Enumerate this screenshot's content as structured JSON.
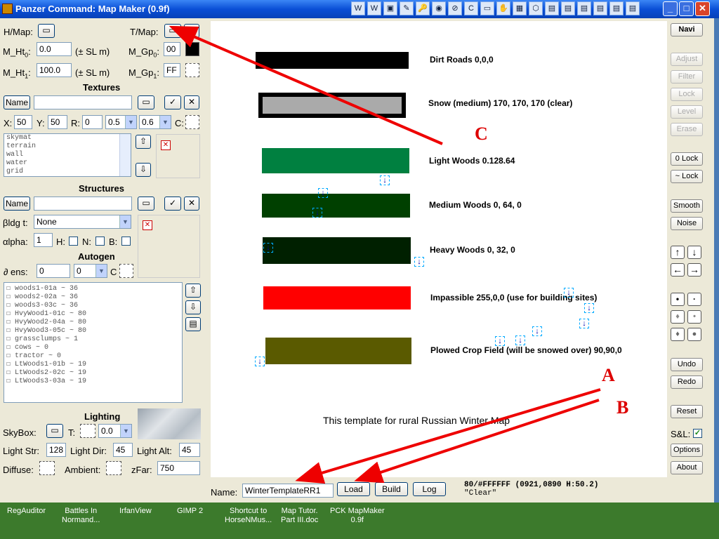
{
  "window": {
    "title": "Panzer Command: Map Maker (0.9f)",
    "min": "_",
    "max": "□",
    "close": "✕"
  },
  "tray_icons": [
    "W",
    "W",
    "▣",
    "✎",
    "🔑",
    "◉",
    "⊘",
    "C",
    "▭",
    "✋",
    "▦",
    "⬡",
    "▤",
    "▤",
    "▤",
    "▤",
    "▤",
    "▤"
  ],
  "left": {
    "hmap_label": "H/Map:",
    "tmap_label": "T/Map:",
    "mht0_label": "M_Ht",
    "mht0_sub": "0",
    "mht0_colon": ":",
    "mht0_value": "0.0",
    "mht0_unit": "(± SL m)",
    "mgp0_label": "M_Gp",
    "mgp0_sub": "0",
    "mgp0_colon": ":",
    "mgp0_value": "00",
    "mht1_label": "M_Ht",
    "mht1_sub": "1",
    "mht1_colon": ":",
    "mht1_value": "100.0",
    "mht1_unit": "(± SL m)",
    "mgp1_label": "M_Gp",
    "mgp1_sub": "1",
    "mgp1_colon": ":",
    "mgp1_value": "FF",
    "textures_header": "Textures",
    "name_button": "Name",
    "x_label": "X:",
    "x_value": "50",
    "y_label": "Y:",
    "y_value": "50",
    "r_label": "R:",
    "r_value": "0",
    "sel1_value": "0.5",
    "sel2_value": "0.6",
    "c_label": "C:",
    "texture_list": [
      "skymat",
      "terrain",
      "wall",
      "water",
      "grid"
    ],
    "structures_header": "Structures",
    "bldg_label": "βldg t:",
    "bldg_value": "None",
    "alpha_label": "αlpha:",
    "alpha_value": "1",
    "h_label": "H:",
    "n_label": "N:",
    "b_label": "B:",
    "autogen_header": "Autogen",
    "dens_label": "∂ ens:",
    "dens_value": "0",
    "dens_sel": "0",
    "c2_label": "C",
    "autogen_list": [
      "☐ woods1-01a ~ 36",
      "☐ woods2-02a ~ 36",
      "☐ woods3-03c ~ 36",
      "☐ HvyWood1-01c ~ 80",
      "☐ HvyWood2-04a ~ 80",
      "☐ HvyWood3-05c ~ 80",
      "☐ grassclumps ~ 1",
      "☐ cows ~ 0",
      "☐ tractor ~ 0",
      "☐ LtWoods1-01b ~ 19",
      "☐ LtWoods2-02c ~ 19",
      "☐ LtWoods3-03a ~ 19"
    ],
    "lighting_header": "Lighting",
    "skybox_label": "SkyBox:",
    "t_label": "T:",
    "skybox_sel": "0.0",
    "lstr_label": "Light Str:",
    "lstr_value": "128",
    "ldir_label": "Light Dir:",
    "ldir_value": "45",
    "lalt_label": "Light Alt:",
    "lalt_value": "45",
    "diffuse_label": "Diffuse:",
    "ambient_label": "Ambient:",
    "zfar_label": "zFar:",
    "zfar_value": "750",
    "check_glyph": "✓",
    "x_glyph": "✕",
    "up_glyph": "⇧",
    "down_glyph": "⇩",
    "folder_glyph": "▭",
    "list_glyph": "▤"
  },
  "canvas": {
    "bands": [
      {
        "label": "Dirt Roads   0,0,0",
        "color": "#000000"
      },
      {
        "label": "Snow (medium)  170, 170, 170     (clear)",
        "color": "#aaaaaa"
      },
      {
        "label": "Light Woods 0.128.64",
        "color": "#008040"
      },
      {
        "label": "Medium Woods 0, 64, 0",
        "color": "#004000"
      },
      {
        "label": "Heavy Woods 0, 32, 0",
        "color": "#002000"
      },
      {
        "label": "Impassible 255,0,0 (use for building sites)",
        "color": "#ff0000"
      },
      {
        "label": "Plowed Crop Field (will be snowed over) 90,90,0",
        "color": "#5a5a00"
      }
    ],
    "caption": "This template for rural Russian Winter Map",
    "marker_glyph": "↓"
  },
  "bottom": {
    "name_label": "Name:",
    "name_value": "WinterTemplateRR1",
    "load": "Load",
    "build": "Build",
    "log": "Log",
    "status_line1": "80/#FFFFFF (0921,0890 H:50.2)",
    "status_line2": "\"Clear\""
  },
  "right": {
    "navi": "Navi",
    "adjust": "Adjust",
    "filter": "Filter",
    "lock": "Lock",
    "level": "Level",
    "erase": "Erase",
    "zero_lock": "0 Lock",
    "approx_lock": "~ Lock",
    "smooth": "Smooth",
    "noise": "Noise",
    "up": "↑",
    "down": "↓",
    "left": "←",
    "right": "→",
    "dot1": "•",
    "dot2": "·",
    "drop1": "♦",
    "drop2": "•",
    "drop3": "♦",
    "drop4": "●",
    "undo": "Undo",
    "redo": "Redo",
    "reset": "Reset",
    "sl_label": "S&L:",
    "sl_check": "✓",
    "options": "Options",
    "about": "About"
  },
  "annotations": {
    "a": "A",
    "b": "B",
    "c": "C"
  },
  "taskbar": [
    {
      "label": "RegAuditor"
    },
    {
      "label": "Battles In\nNormand..."
    },
    {
      "label": "IrfanView"
    },
    {
      "label": "GIMP 2"
    },
    {
      "label": "Shortcut to\nHorseNMus..."
    },
    {
      "label": "Map Tutor.\nPart III.doc"
    },
    {
      "label": "PCK MapMaker\n0.9f"
    }
  ]
}
